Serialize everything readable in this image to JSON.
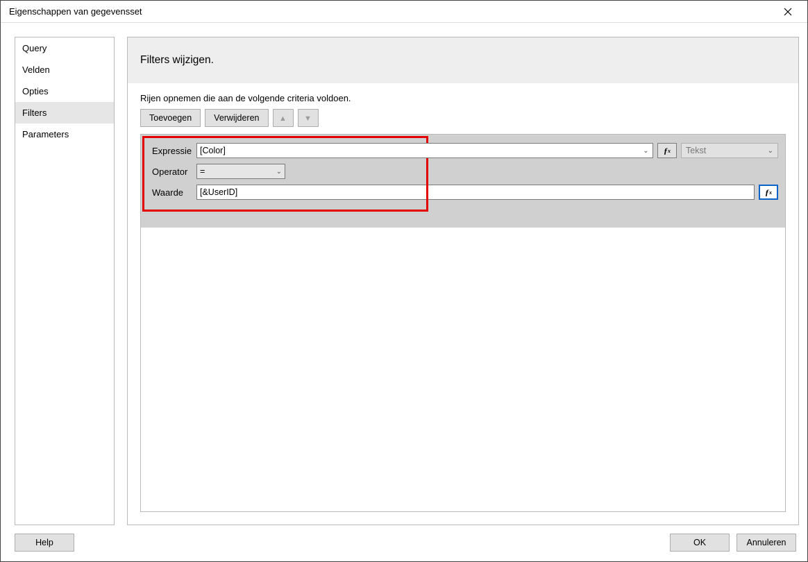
{
  "window": {
    "title": "Eigenschappen van gegevensset"
  },
  "sidebar": {
    "items": [
      {
        "label": "Query",
        "selected": false
      },
      {
        "label": "Velden",
        "selected": false
      },
      {
        "label": "Opties",
        "selected": false
      },
      {
        "label": "Filters",
        "selected": true
      },
      {
        "label": "Parameters",
        "selected": false
      }
    ]
  },
  "main": {
    "heading": "Filters wijzigen.",
    "description": "Rijen opnemen die aan de volgende criteria voldoen.",
    "toolbar": {
      "add": "Toevoegen",
      "delete": "Verwijderen"
    },
    "filter": {
      "expressie_label": "Expressie",
      "expressie_value": "[Color]",
      "operator_label": "Operator",
      "operator_value": "=",
      "waarde_label": "Waarde",
      "waarde_value": "[&UserID]",
      "type_label": "Tekst"
    }
  },
  "footer": {
    "help": "Help",
    "ok": "OK",
    "cancel": "Annuleren"
  }
}
